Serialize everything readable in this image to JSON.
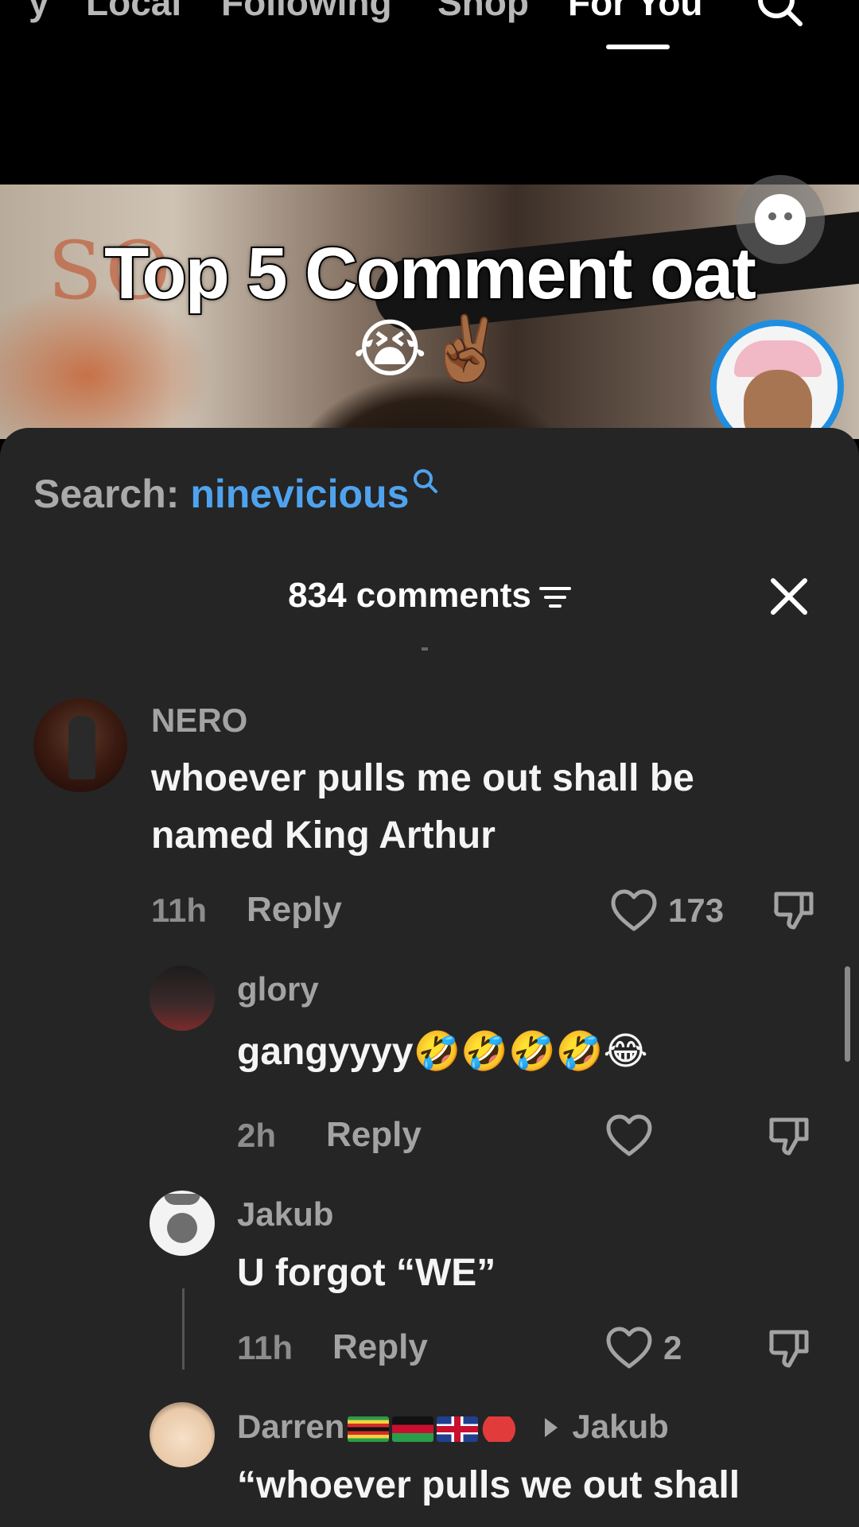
{
  "nav": {
    "tabs": [
      {
        "label": "y"
      },
      {
        "label": "Local"
      },
      {
        "label": "Following"
      },
      {
        "label": "Shop"
      },
      {
        "label": "For You"
      }
    ],
    "active_tab": "For You"
  },
  "video": {
    "caption": "Top 5 Comment oat",
    "caption_emojis": "😭✌🏾",
    "wall_text": "SO"
  },
  "sheet": {
    "search_prefix": "Search: ",
    "search_keyword": "ninevicious",
    "comment_count": "834 comments"
  },
  "comments": [
    {
      "user": "NERO",
      "text": "whoever pulls me out shall be named King Arthur",
      "time": "11h",
      "reply_label": "Reply",
      "likes": "173"
    },
    {
      "user": "glory",
      "text": "gangyyyy🤣🤣🤣🤣😂",
      "time": "2h",
      "reply_label": "Reply",
      "likes": ""
    },
    {
      "user": "Jakub",
      "text": "U forgot “WE”",
      "time": "11h",
      "reply_label": "Reply",
      "likes": "2"
    },
    {
      "user": "Darren",
      "reply_to": "Jakub",
      "text": "“whoever pulls we out shall",
      "time": "",
      "reply_label": "",
      "likes": ""
    }
  ],
  "icons": {
    "top_search": "search-icon",
    "inline_search": "search-icon",
    "filter": "filter-icon",
    "close": "close-icon",
    "like": "heart-icon",
    "dislike": "thumbs-down-icon"
  },
  "colors": {
    "sheet_background": "#252525",
    "keyword": "#4fa3ee",
    "avatar_ring": "#1f8ee0",
    "live_dot": "#ef2950"
  }
}
